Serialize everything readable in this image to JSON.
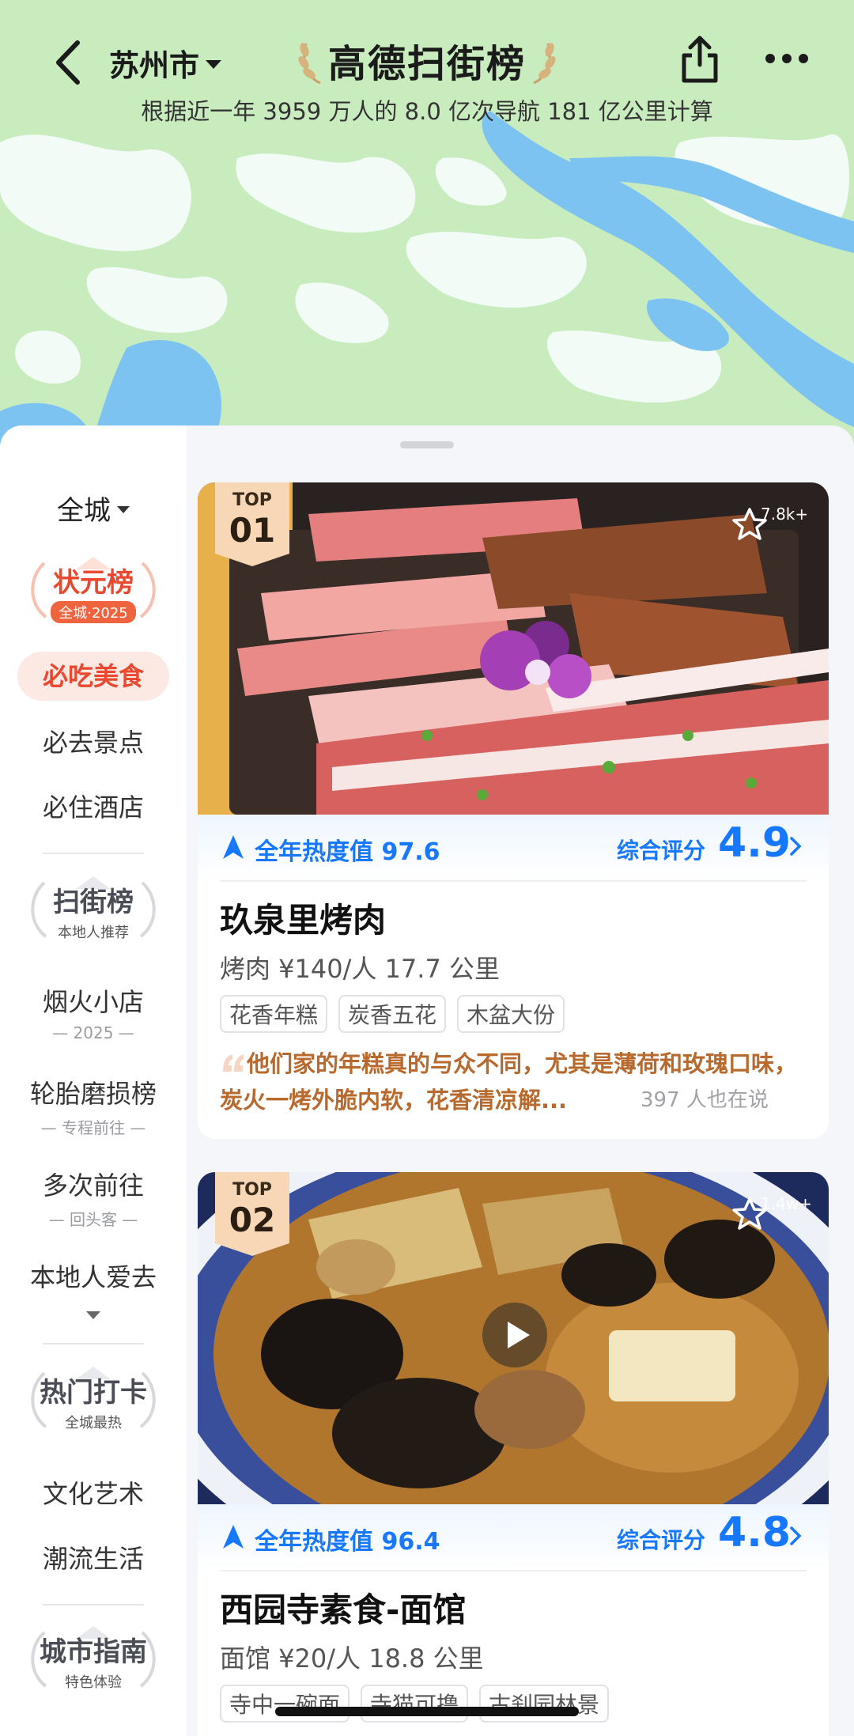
{
  "header": {
    "city": "苏州市",
    "brand": "高德扫街榜",
    "subtitle": "根据近一年 3959 万人的 8.0 亿次导航 181 亿公里计算"
  },
  "sidebar": {
    "scope": "全城",
    "badge1": {
      "title": "状元榜",
      "sub": "全城·2025"
    },
    "items1": [
      "必吃美食",
      "必去景点",
      "必住酒店"
    ],
    "badge2": {
      "title": "扫街榜",
      "sub": "本地人推荐"
    },
    "items2": [
      {
        "label": "烟火小店",
        "sub": "2025"
      },
      {
        "label": "轮胎磨损榜",
        "sub": "专程前往"
      },
      {
        "label": "多次前往",
        "sub": "回头客"
      },
      {
        "label": "本地人爱去",
        "sub": ""
      }
    ],
    "badge3": {
      "title": "热门打卡",
      "sub": "全城最热"
    },
    "items3": [
      "文化艺术",
      "潮流生活"
    ],
    "badge4": {
      "title": "城市指南",
      "sub": "特色体验"
    }
  },
  "cards": [
    {
      "top_label": "TOP",
      "rank": "01",
      "fav_count": "7.8k+",
      "heat": "全年热度值 97.6",
      "score_label": "综合评分",
      "score": "4.9",
      "name": "玖泉里烤肉",
      "meta": "烤肉  ¥140/人  17.7 公里",
      "tags": [
        "花香年糕",
        "炭香五花",
        "木盆大份"
      ],
      "quote": "他们家的年糕真的与众不同，尤其是薄荷和玫瑰口味，炭火一烤外脆内软，花香清凉解...",
      "quote_count": "397 人也在说"
    },
    {
      "top_label": "TOP",
      "rank": "02",
      "fav_count": "1.4w+",
      "heat": "全年热度值 96.4",
      "score_label": "综合评分",
      "score": "4.8",
      "name": "西园寺素食-面馆",
      "meta": "面馆  ¥20/人  18.8 公里",
      "tags": [
        "寺中一碗面",
        "寺猫可撸",
        "古刹园林景"
      ]
    }
  ],
  "colors": {
    "accent_blue": "#1677ff",
    "accent_red": "#e8492f",
    "quote_brown": "#b86a2e",
    "map_land": "#c9ecbf",
    "map_water": "#7cc3f2"
  },
  "icons": [
    "back-chevron-icon",
    "share-icon",
    "more-icon",
    "laurel-icon",
    "star-icon",
    "navigation-arrow-icon",
    "chevron-right-icon",
    "play-icon",
    "quote-icon"
  ]
}
